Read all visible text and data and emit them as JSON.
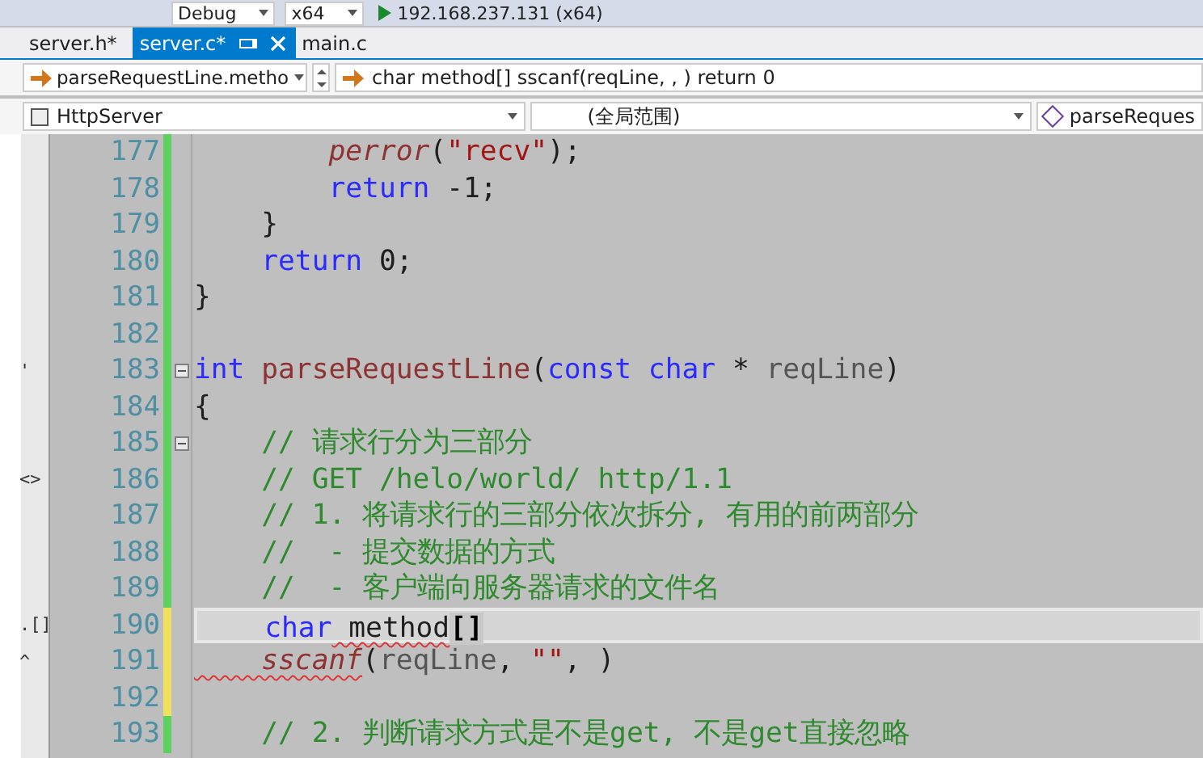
{
  "toolbar": [
    {
      "kind": "dropdown",
      "label": "Debug"
    },
    {
      "kind": "dropdown",
      "label": "x64"
    },
    {
      "kind": "run",
      "label": "192.168.237.131 (x64)"
    }
  ],
  "tabs": [
    {
      "label": "server.h*",
      "selected": false
    },
    {
      "label": "server.c*",
      "selected": true
    },
    {
      "label": "main.c",
      "selected": false
    }
  ],
  "navigation": {
    "member": "parseRequestLine.metho",
    "context": "char method[] sscanf(reqLine, , ) return 0"
  },
  "scope_bar": {
    "project": "HttpServer",
    "scope": "(全局范围)",
    "member": "parseReques"
  },
  "lines": [
    {
      "number": "177",
      "saved": true,
      "fold": false,
      "current": false,
      "tokens": [
        {
          "kind": "library-function",
          "text": "        perror"
        },
        {
          "kind": "plain",
          "text": "("
        },
        {
          "kind": "string",
          "text": "\"recv\""
        },
        {
          "kind": "plain",
          "text": ");"
        }
      ]
    },
    {
      "number": "178",
      "saved": true,
      "fold": false,
      "current": false,
      "tokens": [
        {
          "kind": "keyword",
          "text": "        return"
        },
        {
          "kind": "plain",
          "text": " -1;"
        }
      ]
    },
    {
      "number": "179",
      "saved": true,
      "fold": false,
      "current": false,
      "tokens": [
        {
          "kind": "plain",
          "text": "    }"
        }
      ]
    },
    {
      "number": "180",
      "saved": true,
      "fold": false,
      "current": false,
      "tokens": [
        {
          "kind": "keyword",
          "text": "    return"
        },
        {
          "kind": "plain",
          "text": " 0;"
        }
      ]
    },
    {
      "number": "181",
      "saved": true,
      "fold": false,
      "current": false,
      "tokens": [
        {
          "kind": "plain",
          "text": "}"
        }
      ]
    },
    {
      "number": "182",
      "saved": true,
      "fold": false,
      "current": false
    },
    {
      "number": "183",
      "saved": true,
      "fold": true,
      "current": false,
      "margin": "'",
      "tokens": [
        {
          "kind": "keyword",
          "text": "int"
        },
        {
          "kind": "function",
          "text": " parseRequestLine"
        },
        {
          "kind": "plain",
          "text": "("
        },
        {
          "kind": "keyword",
          "text": "const"
        },
        {
          "kind": "keyword",
          "text": " char"
        },
        {
          "kind": "plain",
          "text": " *"
        },
        {
          "kind": "parameter",
          "text": " reqLine"
        },
        {
          "kind": "plain",
          "text": ")"
        }
      ]
    },
    {
      "number": "184",
      "saved": true,
      "fold": false,
      "current": false,
      "tokens": [
        {
          "kind": "plain",
          "text": "{"
        }
      ]
    },
    {
      "number": "185",
      "saved": true,
      "fold": true,
      "current": false,
      "tokens": [
        {
          "kind": "comment",
          "text": "    // 请求行分为三部分"
        }
      ]
    },
    {
      "number": "186",
      "saved": true,
      "fold": false,
      "current": false,
      "margin": "<>",
      "tokens": [
        {
          "kind": "comment",
          "text": "    // GET /helo/world/ http/1.1"
        }
      ]
    },
    {
      "number": "187",
      "saved": true,
      "fold": false,
      "current": false,
      "tokens": [
        {
          "kind": "comment",
          "text": "    // 1. 将请求行的三部分依次拆分, 有用的前两部分"
        }
      ]
    },
    {
      "number": "188",
      "saved": true,
      "fold": false,
      "current": false,
      "tokens": [
        {
          "kind": "comment",
          "text": "    //  - 提交数据的方式"
        }
      ]
    },
    {
      "number": "189",
      "saved": true,
      "fold": false,
      "current": false,
      "tokens": [
        {
          "kind": "comment",
          "text": "    //  - 客户端向服务器请求的文件名"
        }
      ]
    },
    {
      "number": "190",
      "saved": false,
      "fold": false,
      "current": true,
      "margin": ".[]",
      "tokens": [
        {
          "kind": "keyword",
          "text": "    char"
        },
        {
          "kind": "plain",
          "text": " method",
          "error": true
        },
        {
          "kind": "brace-match",
          "text": "[]"
        }
      ]
    },
    {
      "number": "191",
      "saved": false,
      "fold": false,
      "current": false,
      "margin": "^",
      "tokens": [
        {
          "kind": "library-function",
          "text": "    sscanf",
          "error": true
        },
        {
          "kind": "plain",
          "text": "("
        },
        {
          "kind": "parameter",
          "text": "reqLine"
        },
        {
          "kind": "plain",
          "text": ","
        },
        {
          "kind": "string",
          "text": " \"\""
        },
        {
          "kind": "plain",
          "text": ", )"
        }
      ]
    },
    {
      "number": "192",
      "saved": false,
      "fold": false,
      "current": false
    },
    {
      "number": "193",
      "saved": true,
      "fold": false,
      "current": false,
      "tokens": [
        {
          "kind": "comment",
          "text": "    // 2. 判断请求方式是不是get, 不是get直接忽略"
        }
      ]
    }
  ]
}
